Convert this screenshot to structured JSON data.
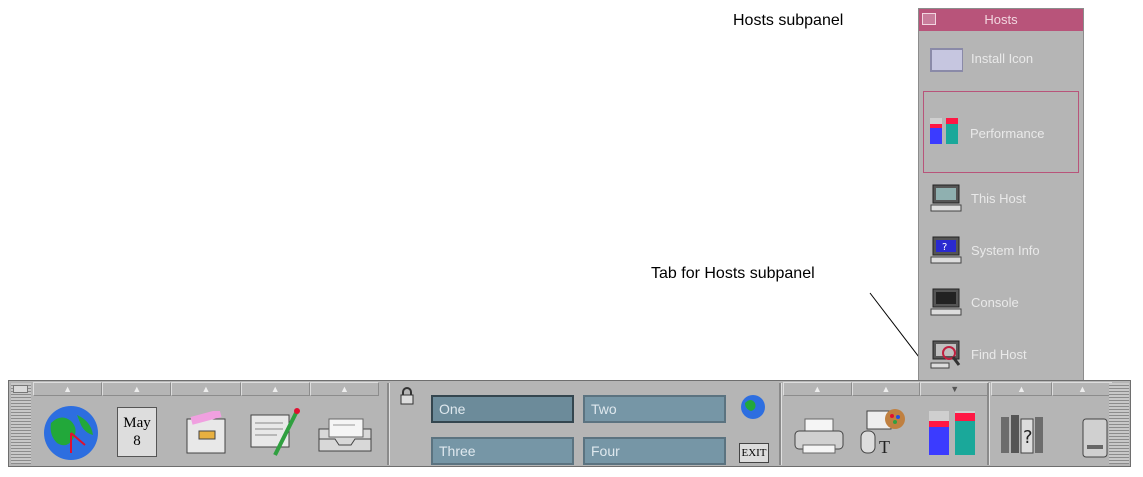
{
  "callouts": {
    "hosts_subpanel": "Hosts subpanel",
    "tab_for_hosts": "Tab for Hosts subpanel"
  },
  "subpanel": {
    "title": "Hosts",
    "items": [
      {
        "label": "Install Icon",
        "icon": "install-icon"
      },
      {
        "label": "Performance",
        "icon": "performance-meter-icon"
      },
      {
        "label": "This Host",
        "icon": "terminal-icon"
      },
      {
        "label": "System Info",
        "icon": "system-info-icon"
      },
      {
        "label": "Console",
        "icon": "console-icon"
      },
      {
        "label": "Find Host",
        "icon": "find-host-icon"
      }
    ]
  },
  "front_panel": {
    "calendar": {
      "month": "May",
      "day": "8"
    },
    "workspaces": [
      "One",
      "Two",
      "Three",
      "Four"
    ],
    "exit_label": "EXIT",
    "colors": {
      "panel_bg": "#b5b5b5",
      "workspace": "#7696a6",
      "subpanel_title": "#b8547a"
    }
  }
}
